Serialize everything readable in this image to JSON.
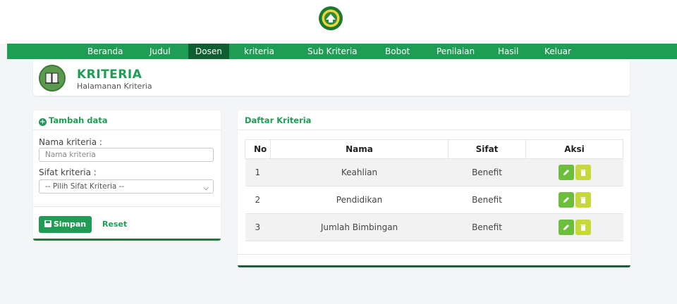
{
  "nav": {
    "items": [
      {
        "label": "Beranda",
        "active": false
      },
      {
        "label": "Judul",
        "active": false
      },
      {
        "label": "Dosen",
        "active": true
      },
      {
        "label": "kriteria",
        "active": false
      },
      {
        "label": "Sub Kriteria",
        "active": false
      },
      {
        "label": "Bobot",
        "active": false
      },
      {
        "label": "Penilaian",
        "active": false
      },
      {
        "label": "Hasil",
        "active": false
      },
      {
        "label": "Keluar",
        "active": false
      }
    ]
  },
  "header": {
    "title": "KRITERIA",
    "subtitle": "Halamanan Kriteria",
    "icon": "book-icon"
  },
  "form": {
    "title": "Tambah data",
    "name_label": "Nama kriteria :",
    "name_placeholder": "Nama kriteria",
    "name_value": "",
    "sifat_label": "Sifat kriteria :",
    "sifat_selected": "-- Pilih Sifat Kriteria --",
    "save_label": "Simpan",
    "reset_label": "Reset"
  },
  "list": {
    "title": "Daftar Kriteria",
    "columns": [
      "No",
      "Nama",
      "Sifat",
      "Aksi"
    ],
    "rows": [
      {
        "no": "1",
        "nama": "Keahlian",
        "sifat": "Benefit"
      },
      {
        "no": "2",
        "nama": "Pendidikan",
        "sifat": "Benefit"
      },
      {
        "no": "3",
        "nama": "Jumlah Bimbingan",
        "sifat": "Benefit"
      }
    ]
  },
  "colors": {
    "primary": "#1f9d55",
    "nav_active": "#0f5f30",
    "edit": "#6bbf3a",
    "delete": "#c6d83a"
  }
}
